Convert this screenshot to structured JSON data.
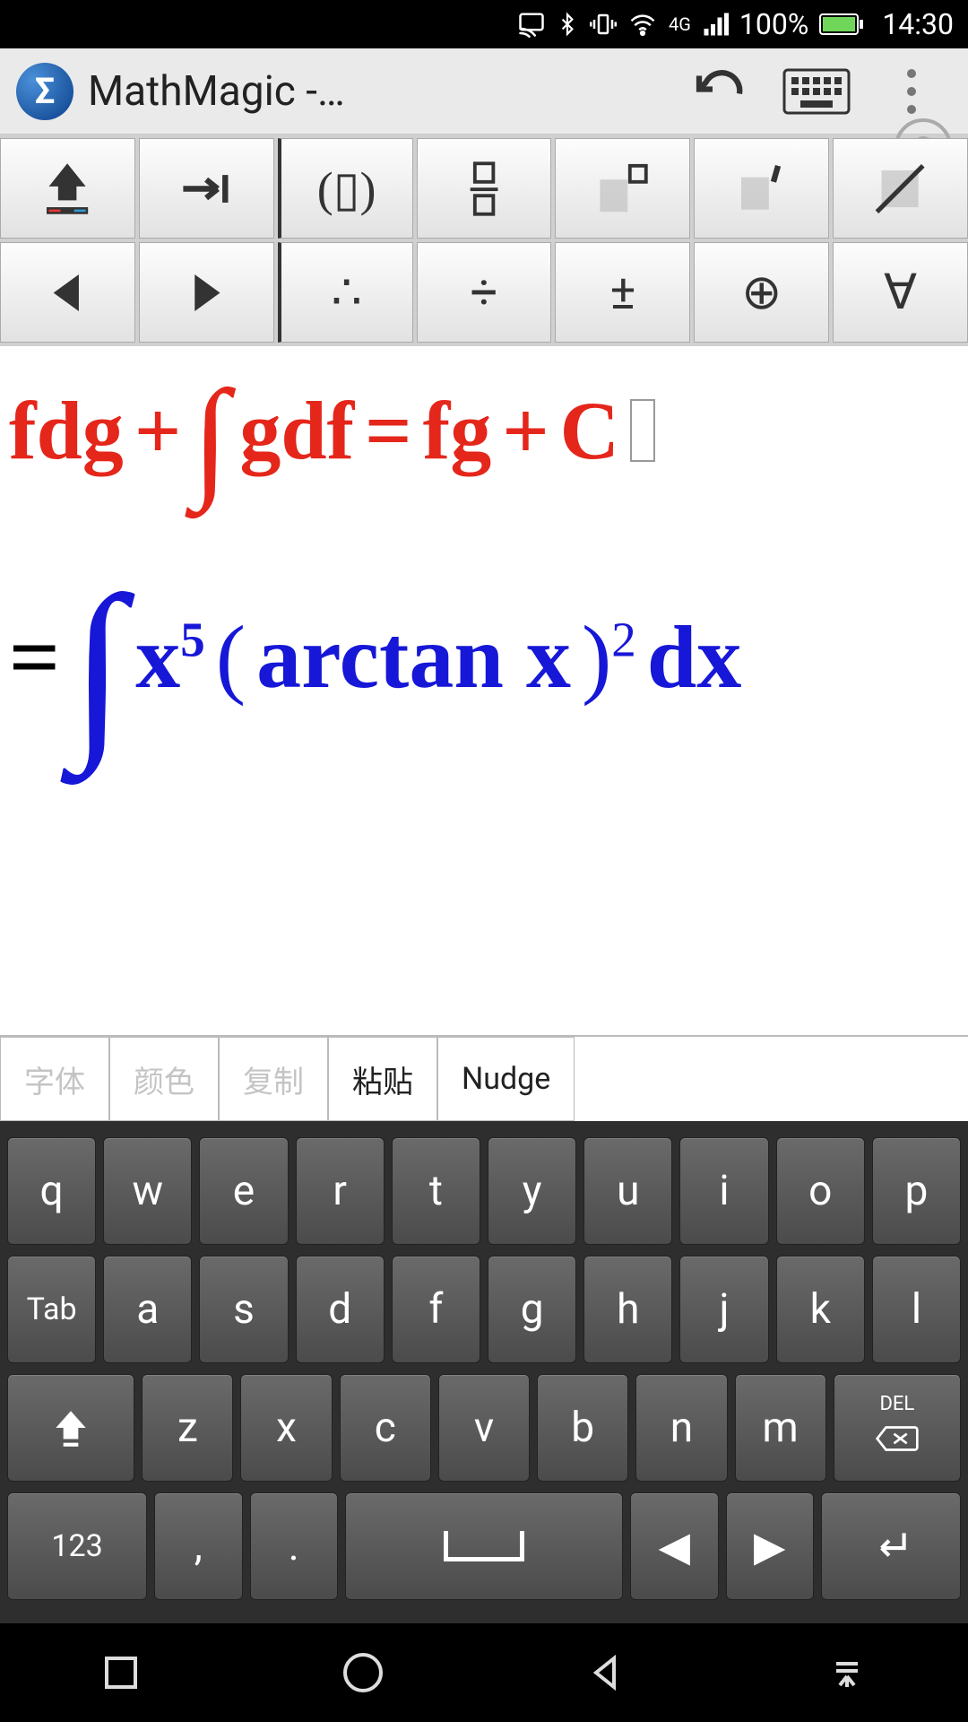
{
  "status": {
    "battery_pct": "100%",
    "time": "14:30",
    "network": "4G"
  },
  "app": {
    "title": "MathMagic  -…",
    "logo_glyph": "Σ"
  },
  "appbar_icons": {
    "undo": "undo-icon",
    "keyboard": "keyboard-icon",
    "overflow": "overflow-icon"
  },
  "toolbar": {
    "row1": [
      "shift-up",
      "tab-right",
      "parentheses",
      "fraction",
      "superscript-box",
      "prime-box",
      "strike-box"
    ],
    "row2": [
      "nav-left",
      "nav-right",
      "therefore",
      "division",
      "plus-minus",
      "circled-plus",
      "for-all"
    ],
    "glyphs": {
      "therefore": "∴",
      "division": "÷",
      "plus-minus": "±",
      "circled-plus": "⊕",
      "for-all": "∀",
      "parentheses": "(▯)"
    }
  },
  "equations": {
    "line1": {
      "color": "red",
      "parts": [
        "fdg",
        "+",
        "∫",
        "gdf",
        "=",
        "fg",
        "+",
        "C"
      ]
    },
    "line2": {
      "color": "blue",
      "lead": "=",
      "integral": "∫",
      "x_base": "x",
      "x_exp": "5",
      "open": "(",
      "fn": "arctan x",
      "close": ")",
      "close_exp": "2",
      "dx": "dx"
    }
  },
  "edit_tabs": [
    {
      "label": "字体",
      "enabled": false
    },
    {
      "label": "颜色",
      "enabled": false
    },
    {
      "label": "复制",
      "enabled": false
    },
    {
      "label": "粘贴",
      "enabled": true
    },
    {
      "label": "Nudge",
      "enabled": true
    }
  ],
  "keyboard": {
    "row1": [
      "q",
      "w",
      "e",
      "r",
      "t",
      "y",
      "u",
      "i",
      "o",
      "p"
    ],
    "row2_lead": "Tab",
    "row2": [
      "a",
      "s",
      "d",
      "f",
      "g",
      "h",
      "j",
      "k",
      "l"
    ],
    "row3_shift": "⇧",
    "row3": [
      "z",
      "x",
      "c",
      "v",
      "b",
      "n",
      "m"
    ],
    "row3_del_top": "DEL",
    "row4_mode": "123",
    "row4_comma": ",",
    "row4_period": ".",
    "row4_left": "◀",
    "row4_right": "▶",
    "row4_enter": "↵"
  }
}
